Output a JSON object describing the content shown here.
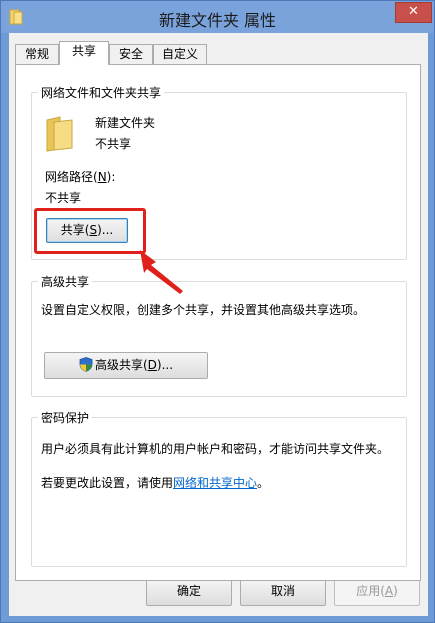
{
  "window": {
    "title": "新建文件夹 属性",
    "close_glyph": "✕"
  },
  "tabs": [
    {
      "label": "常规",
      "active": false
    },
    {
      "label": "共享",
      "active": true
    },
    {
      "label": "安全",
      "active": false
    },
    {
      "label": "自定义",
      "active": false
    }
  ],
  "network_sharing": {
    "title": "网络文件和文件夹共享",
    "folder_name": "新建文件夹",
    "folder_status": "不共享",
    "path_label_pre": "网络路径(",
    "path_label_key": "N",
    "path_label_post": "):",
    "path_value": "不共享",
    "share_button": {
      "pre": "共享(",
      "key": "S",
      "post": ")..."
    }
  },
  "advanced_sharing": {
    "title": "高级共享",
    "description": "设置自定义权限，创建多个共享，并设置其他高级共享选项。",
    "button": {
      "pre": "高级共享(",
      "key": "D",
      "post": ")..."
    }
  },
  "password_protection": {
    "title": "密码保护",
    "description": "用户必须具有此计算机的用户帐户和密码，才能访问共享文件夹。",
    "change_pre": "若要更改此设置，请使用",
    "change_link": "网络和共享中心",
    "change_post": "。"
  },
  "footer": {
    "ok": "确定",
    "cancel": "取消",
    "apply_pre": "应用(",
    "apply_key": "A",
    "apply_post": ")"
  },
  "colors": {
    "annotation": "#e0201a",
    "link": "#0066cc",
    "folder": "#f3d36b"
  },
  "icons": {
    "title": "folder-icon",
    "folder": "folder-icon",
    "shield": "uac-shield-icon",
    "arrow": "annotation-arrow"
  }
}
